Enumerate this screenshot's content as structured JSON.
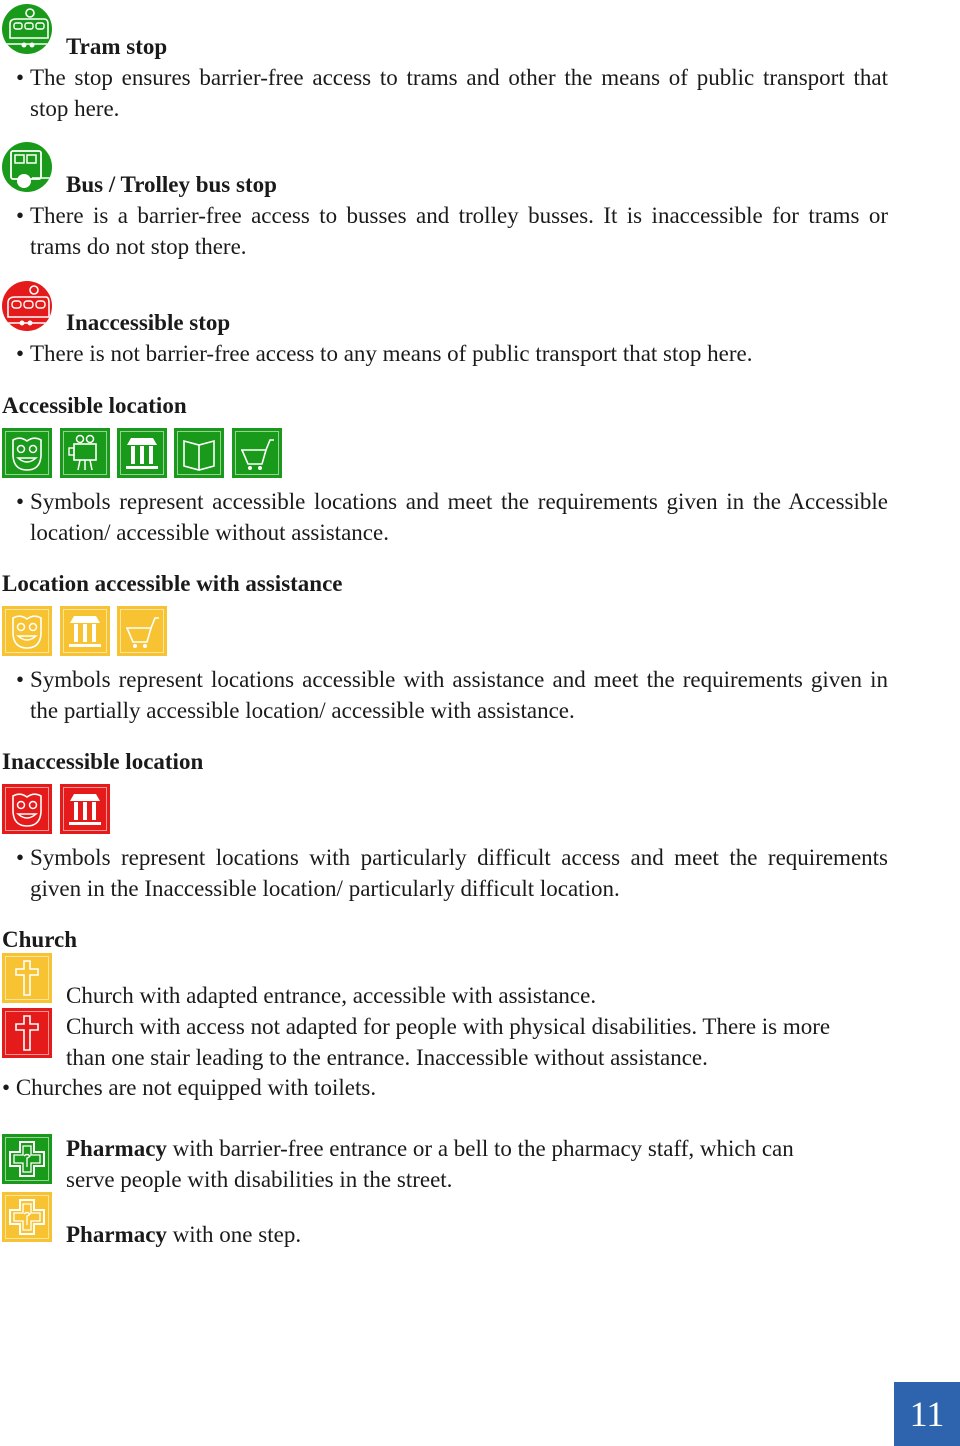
{
  "colors": {
    "accessible": "#1a9a1a",
    "with_assistance": "#f7c332",
    "inaccessible": "#e51a1a",
    "page_badge": "#2e63ad"
  },
  "stops": [
    {
      "icon": "tram-stop-icon",
      "title": "Tram stop",
      "bullet": "•",
      "description": "The stop ensures barrier-free access to trams and other the means of public transport that stop here."
    },
    {
      "icon": "bus-trolley-stop-icon",
      "title": "Bus / Trolley bus stop",
      "bullet": "•",
      "description": "There is a barrier-free access to busses and trolley busses. It is inaccessible for trams or trams do not stop there."
    },
    {
      "icon": "inaccessible-stop-icon",
      "title": "Inaccessible stop",
      "bullet": "•",
      "description": "There is not barrier-free access to any means of public transport that stop here."
    }
  ],
  "locations": [
    {
      "heading": "Accessible location",
      "icons": [
        "theatre-mask-icon",
        "film-camera-icon",
        "museum-icon",
        "book-icon",
        "shopping-cart-icon"
      ],
      "bullet": "•",
      "description": "Symbols represent accessible locations and meet the requirements given in the Accessible location/ accessible without assistance."
    },
    {
      "heading": "Location accessible with assistance",
      "icons": [
        "theatre-mask-icon",
        "museum-icon",
        "shopping-cart-icon"
      ],
      "bullet": "•",
      "description": "Symbols represent locations accessible with assistance and meet the requirements given in the partially accessible location/ accessible with assistance."
    },
    {
      "heading": "Inaccessible location",
      "icons": [
        "theatre-mask-icon",
        "museum-icon"
      ],
      "bullet": "•",
      "description": "Symbols represent locations with particularly difficult access and meet the requirements given in the Inaccessible location/ particularly difficult location."
    }
  ],
  "church": {
    "heading": "Church",
    "items": [
      {
        "icon": "church-cross-icon",
        "status": "with assistance",
        "line1": "Church with adapted entrance, accessible with assistance."
      },
      {
        "icon": "church-cross-icon",
        "status": "inaccessible",
        "line1": "Church with access not adapted for people with physical disabilities. There is more",
        "line2": "than one stair leading to the entrance. Inaccessible without assistance."
      }
    ],
    "bullet": "•",
    "note": "Churches are not equipped with toilets."
  },
  "pharmacy": {
    "items": [
      {
        "icon": "pharmacy-cross-icon",
        "status": "accessible",
        "bold": "Pharmacy",
        "line1": " with barrier-free entrance or a bell to the pharmacy staff, which can",
        "line2": "serve people with disabilities in the street."
      },
      {
        "icon": "pharmacy-cross-icon",
        "status": "with assistance",
        "bold": "Pharmacy",
        "line1": " with one step."
      }
    ]
  },
  "page_number": "11"
}
